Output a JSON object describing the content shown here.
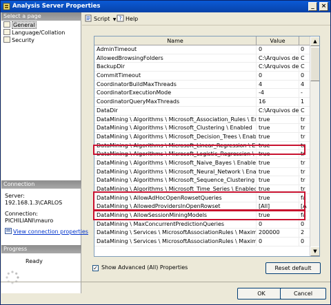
{
  "window": {
    "title": "Analysis Server Properties"
  },
  "left": {
    "select_header": "Select a page",
    "pages": [
      "General",
      "Language/Collation",
      "Security"
    ],
    "connection_header": "Connection",
    "server_label": "Server:",
    "server_value": "192.168.1.3\\CARLOS",
    "connection_label": "Connection:",
    "connection_value": "PICHILIANI\\mauro",
    "view_link": "View connection properties",
    "progress_header": "Progress",
    "progress_status": "Ready"
  },
  "toolbar": {
    "script_label": "Script",
    "help_label": "Help"
  },
  "grid": {
    "columns": [
      "Name",
      "Value",
      ""
    ],
    "rows": [
      [
        "AdminTimeout",
        "0",
        "0"
      ],
      [
        "AllowedBrowsingFolders",
        "C:\\Arquivos de ...",
        "C"
      ],
      [
        "BackupDir",
        "C:\\Arquivos de ...",
        "C"
      ],
      [
        "CommitTimeout",
        "0",
        "0"
      ],
      [
        "CoordinatorBuildMaxThreads",
        "4",
        "4"
      ],
      [
        "CoordinatorExecutionMode",
        "-4",
        "-"
      ],
      [
        "CoordinatorQueryMaxThreads",
        "16",
        "1"
      ],
      [
        "DataDir",
        "C:\\Arquivos de ...",
        "C"
      ],
      [
        "DataMining \\ Algorithms \\ Microsoft_Association_Rules \\ Enabled",
        "true",
        "tr"
      ],
      [
        "DataMining \\ Algorithms \\ Microsoft_Clustering \\ Enabled",
        "true",
        "tr"
      ],
      [
        "DataMining \\ Algorithms \\ Microsoft_Decision_Trees \\ Enabled",
        "true",
        "tr"
      ],
      [
        "DataMining \\ Algorithms \\ Microsoft_Linear_Regression \\ Enabled",
        "true",
        "tr"
      ],
      [
        "DataMining \\ Algorithms \\ Microsoft_Logistic_Regression \\ Enabled",
        "true",
        "tr"
      ],
      [
        "DataMining \\ Algorithms \\ Microsoft_Naive_Bayes \\ Enabled",
        "true",
        "tr"
      ],
      [
        "DataMining \\ Algorithms \\ Microsoft_Neural_Network \\ Enabled",
        "true",
        "tr"
      ],
      [
        "DataMining \\ Algorithms \\ Microsoft_Sequence_Clustering \\ Enabled",
        "true",
        "tr"
      ],
      [
        "DataMining \\ Algorithms \\ Microsoft_Time_Series \\ Enabled",
        "true",
        "tr"
      ],
      [
        "DataMining \\ AllowAdHocOpenRowsetQueries",
        "true",
        "fa"
      ],
      [
        "DataMining \\ AllowedProvidersInOpenRowset",
        "[All]",
        "[A"
      ],
      [
        "DataMining \\ AllowSessionMiningModels",
        "true",
        "fa"
      ],
      [
        "DataMining \\ MaxConcurrentPredictionQueries",
        "0",
        "0"
      ],
      [
        "DataMining \\ Services \\ MicrosoftAssociationRules \\ MaximumItems...",
        "200000",
        "2"
      ],
      [
        "DataMining \\ Services \\ MicrosoftAssociationRules \\ MaximumItems...",
        "0",
        "0"
      ]
    ]
  },
  "bottom": {
    "show_advanced": "Show Advanced (All) Properties",
    "reset_default": "Reset default",
    "ok": "OK",
    "cancel": "Cancel"
  }
}
